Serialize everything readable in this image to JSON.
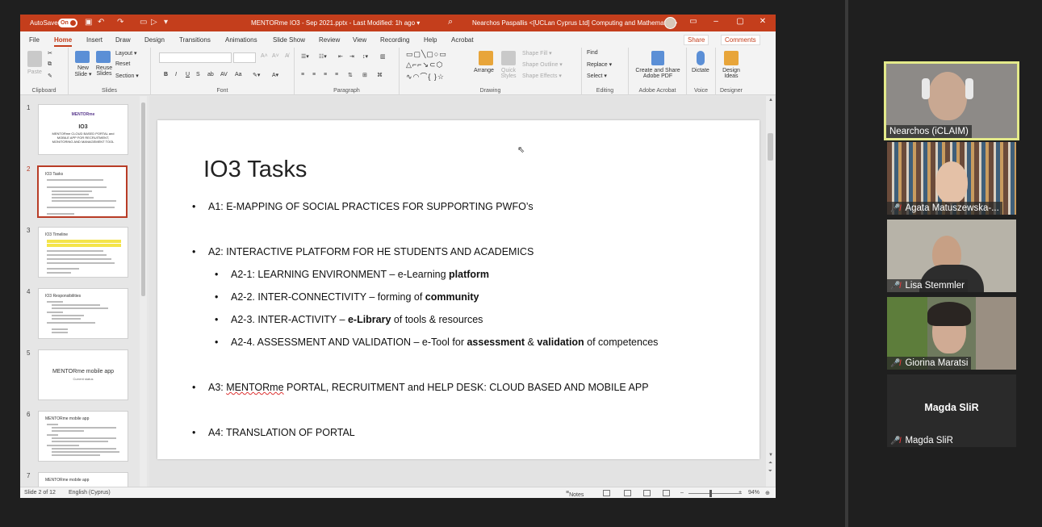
{
  "window": {
    "autosave_label": "AutoSave",
    "autosave_state": "On",
    "document_title": "MENTORme IO3 - Sep 2021.pptx  -  Last Modified: 1h ago  ▾",
    "user_name": "Nearchos Paspallis <[UCLan Cyprus Ltd] Computing and Mathematics>"
  },
  "ribbon_tabs": [
    "File",
    "Home",
    "Insert",
    "Draw",
    "Design",
    "Transitions",
    "Animations",
    "Slide Show",
    "Review",
    "View",
    "Recording",
    "Help",
    "Acrobat"
  ],
  "ribbon_actions": {
    "share": "Share",
    "comments": "Comments"
  },
  "ribbon": {
    "clipboard": {
      "label": "Clipboard",
      "paste": "Paste"
    },
    "slides": {
      "label": "Slides",
      "new_slide": "New Slide ▾",
      "reuse_slides": "Reuse Slides",
      "layout": "Layout ▾",
      "reset": "Reset",
      "section": "Section ▾"
    },
    "font": {
      "label": "Font"
    },
    "paragraph": {
      "label": "Paragraph"
    },
    "drawing": {
      "label": "Drawing",
      "arrange": "Arrange",
      "quick_styles": "Quick Styles",
      "shape_fill": "Shape Fill ▾",
      "shape_outline": "Shape Outline ▾",
      "shape_effects": "Shape Effects ▾"
    },
    "editing": {
      "label": "Editing",
      "find": "Find",
      "replace": "Replace ▾",
      "select": "Select ▾"
    },
    "acrobat": {
      "label": "Adobe Acrobat",
      "create_share": "Create and Share Adobe PDF"
    },
    "voice": {
      "label": "Voice",
      "dictate": "Dictate"
    },
    "designer": {
      "label": "Designer",
      "design_ideas": "Design Ideas"
    }
  },
  "thumbnails": [
    {
      "num": "1",
      "title": "IO3",
      "subtitle": "MENTORme CLOUD BASED PORTAL and MOBILE APP FOR RECRUITMENT, MONITORING AND MANAGEMENT TOOL",
      "logo": "MENTORme"
    },
    {
      "num": "2",
      "title": "IO3 Tasks"
    },
    {
      "num": "3",
      "title": "IO3 Timeline"
    },
    {
      "num": "4",
      "title": "IO3 Responsibilities"
    },
    {
      "num": "5",
      "title": "MENTORme mobile app",
      "subtitle": "Current status"
    },
    {
      "num": "6",
      "title": "MENTORme mobile app"
    },
    {
      "num": "7",
      "title": "MENTORme mobile app"
    }
  ],
  "slide": {
    "title": "IO3 Tasks",
    "a1": "A1: E-MAPPING OF SOCIAL PRACTICES FOR SUPPORTING PWFO’s",
    "a2": "A2: INTERACTIVE PLATFORM FOR HE STUDENTS AND ACADEMICS",
    "a2_1_pre": "A2-1: LEARNING ENVIRONMENT – e-Learning ",
    "a2_1_bold": "platform",
    "a2_2_pre": "A2-2. INTER-CONNECTIVITY – forming of ",
    "a2_2_bold": "community",
    "a2_3_pre": "A2-3. INTER-ACTIVITY – ",
    "a2_3_bold": "e-Library",
    "a2_3_post": " of tools & resources",
    "a2_4_pre": "A2-4. ASSESSMENT AND VALIDATION – e-Tool for ",
    "a2_4_bold1": "assessment",
    "a2_4_mid": " & ",
    "a2_4_bold2": "validation",
    "a2_4_post": " of competences",
    "a3_pre": "A3: ",
    "a3_squig": "MENTORme",
    "a3_post": " PORTAL, RECRUITMENT and HELP DESK: CLOUD BASED AND MOBILE APP",
    "a4": "A4: TRANSLATION OF PORTAL"
  },
  "status": {
    "slide_info": "Slide 2 of 12",
    "language": "English (Cyprus)",
    "notes": "Notes",
    "zoom": "94%"
  },
  "participants": [
    {
      "name": "Nearchos (iCLAIM)",
      "muted": false,
      "active": true
    },
    {
      "name": "Agata Matuszewska-...",
      "muted": true
    },
    {
      "name": "Lisa Stemmler",
      "muted": true
    },
    {
      "name": "Giorina Maratsi",
      "muted": true
    },
    {
      "name": "Magda SliR",
      "muted": true,
      "no_video": true
    }
  ],
  "colors": {
    "ppt_brand": "#c43e1c",
    "active_speaker": "#e3e98a",
    "muted_red": "#e23b3b"
  }
}
